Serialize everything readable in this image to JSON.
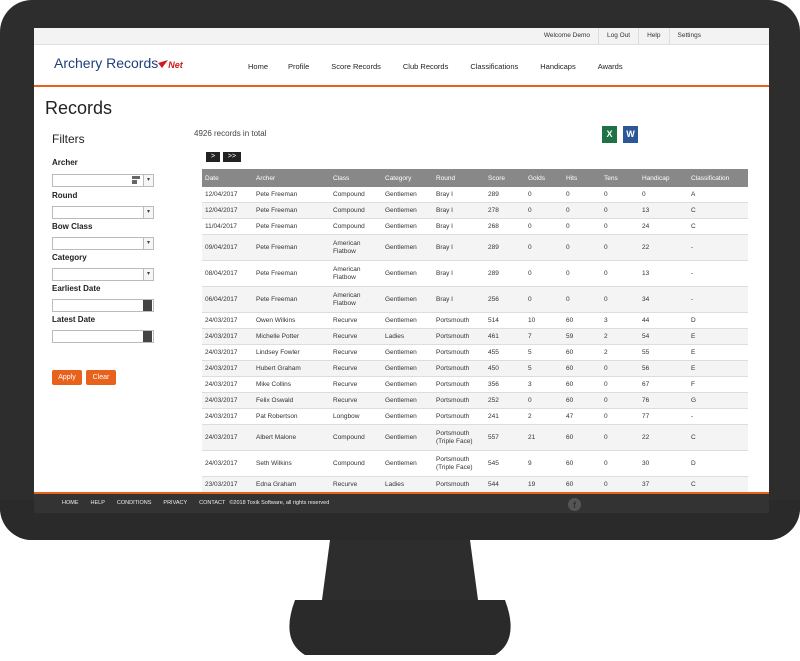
{
  "util_links": [
    "Welcome Demo",
    "Log Out",
    "Help",
    "Settings"
  ],
  "logo": {
    "main": "Archery Records",
    "suffix": "Net"
  },
  "nav": [
    "Home",
    "Profile",
    "Score Records",
    "Club Records",
    "Classifications",
    "Handicaps",
    "Awards"
  ],
  "page_title": "Records",
  "filters": {
    "title": "Filters",
    "labels": [
      "Archer",
      "Round",
      "Bow Class",
      "Category",
      "Earliest Date",
      "Latest Date"
    ],
    "apply": "Apply",
    "clear": "Clear"
  },
  "total_text": "4926 records in total",
  "pager": {
    "next": ">",
    "last": ">>"
  },
  "table": {
    "headers": [
      "Date",
      "Archer",
      "Class",
      "Category",
      "Round",
      "Score",
      "Golds",
      "Hits",
      "Tens",
      "Handicap",
      "Classification"
    ],
    "rows": [
      [
        "12/04/2017",
        "Pete Freeman",
        "Compound",
        "Gentlemen",
        "Bray I",
        "289",
        "0",
        "0",
        "0",
        "0",
        "A"
      ],
      [
        "12/04/2017",
        "Pete Freeman",
        "Compound",
        "Gentlemen",
        "Bray I",
        "278",
        "0",
        "0",
        "0",
        "13",
        "C"
      ],
      [
        "11/04/2017",
        "Pete Freeman",
        "Compound",
        "Gentlemen",
        "Bray I",
        "268",
        "0",
        "0",
        "0",
        "24",
        "C"
      ],
      [
        "09/04/2017",
        "Pete Freeman",
        "American Flatbow",
        "Gentlemen",
        "Bray I",
        "289",
        "0",
        "0",
        "0",
        "22",
        "-"
      ],
      [
        "08/04/2017",
        "Pete Freeman",
        "American Flatbow",
        "Gentlemen",
        "Bray I",
        "289",
        "0",
        "0",
        "0",
        "13",
        "-"
      ],
      [
        "06/04/2017",
        "Pete Freeman",
        "American Flatbow",
        "Gentlemen",
        "Bray I",
        "256",
        "0",
        "0",
        "0",
        "34",
        "-"
      ],
      [
        "24/03/2017",
        "Owen Wilkins",
        "Recurve",
        "Gentlemen",
        "Portsmouth",
        "514",
        "10",
        "60",
        "3",
        "44",
        "D"
      ],
      [
        "24/03/2017",
        "Michelle Potter",
        "Recurve",
        "Ladies",
        "Portsmouth",
        "461",
        "7",
        "59",
        "2",
        "54",
        "E"
      ],
      [
        "24/03/2017",
        "Lindsey Fowler",
        "Recurve",
        "Gentlemen",
        "Portsmouth",
        "455",
        "5",
        "60",
        "2",
        "55",
        "E"
      ],
      [
        "24/03/2017",
        "Hubert Graham",
        "Recurve",
        "Gentlemen",
        "Portsmouth",
        "450",
        "5",
        "60",
        "0",
        "56",
        "E"
      ],
      [
        "24/03/2017",
        "Mike Collins",
        "Recurve",
        "Gentlemen",
        "Portsmouth",
        "356",
        "3",
        "60",
        "0",
        "67",
        "F"
      ],
      [
        "24/03/2017",
        "Felix Oswald",
        "Recurve",
        "Gentlemen",
        "Portsmouth",
        "252",
        "0",
        "60",
        "0",
        "76",
        "G"
      ],
      [
        "24/03/2017",
        "Pat Robertson",
        "Longbow",
        "Gentlemen",
        "Portsmouth",
        "241",
        "2",
        "47",
        "0",
        "77",
        "-"
      ],
      [
        "24/03/2017",
        "Albert Malone",
        "Compound",
        "Gentlemen",
        "Portsmouth (Triple Face)",
        "557",
        "21",
        "60",
        "0",
        "22",
        "C"
      ],
      [
        "24/03/2017",
        "Seth Wilkins",
        "Compound",
        "Gentlemen",
        "Portsmouth (Triple Face)",
        "545",
        "9",
        "60",
        "0",
        "30",
        "D"
      ],
      [
        "23/03/2017",
        "Edna Graham",
        "Recurve",
        "Ladies",
        "Portsmouth",
        "544",
        "19",
        "60",
        "0",
        "37",
        "C"
      ]
    ]
  },
  "footer": {
    "links": [
      "HOME",
      "HELP",
      "CONDITIONS",
      "PRIVACY",
      "CONTACT"
    ],
    "copyright": "©2018 Toxik Software, all rights reserved"
  },
  "icons": {
    "excel": "excel-icon",
    "word": "word-icon",
    "facebook": "facebook-icon",
    "calendar": "calendar-icon"
  },
  "colors": {
    "accent": "#e8621c",
    "header_gray": "#888888",
    "logo_blue": "#1e3f7b",
    "logo_red": "#d0191c"
  }
}
